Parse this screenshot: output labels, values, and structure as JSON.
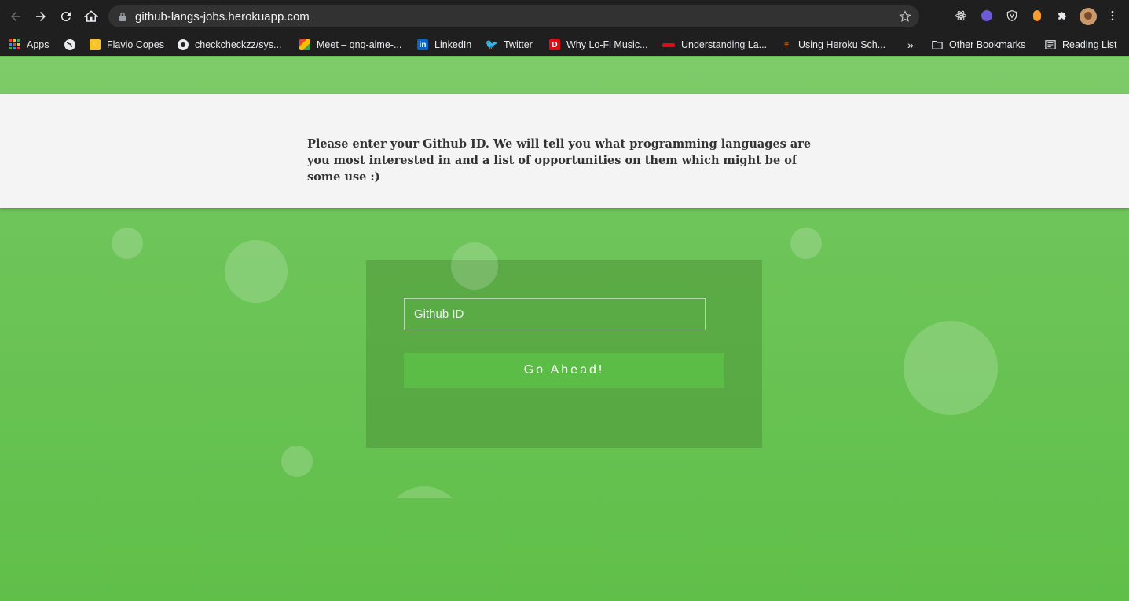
{
  "browser": {
    "url": "github-langs-jobs.herokuapp.com",
    "bookmarks": [
      {
        "label": "Apps",
        "icon": "apps-grid-icon"
      },
      {
        "label": "",
        "icon": "globe-icon"
      },
      {
        "label": "Flavio Copes",
        "icon": "flavio-copes-icon"
      },
      {
        "label": "checkcheckzz/sys...",
        "icon": "github-icon"
      },
      {
        "label": "Meet – qnq-aime-...",
        "icon": "meet-icon"
      },
      {
        "label": "LinkedIn",
        "icon": "linkedin-icon"
      },
      {
        "label": "Twitter",
        "icon": "twitter-icon"
      },
      {
        "label": "Why Lo-Fi Music...",
        "icon": "d-icon"
      },
      {
        "label": "Understanding La...",
        "icon": "red-bar-icon"
      },
      {
        "label": "Using Heroku Sch...",
        "icon": "stackoverflow-icon"
      }
    ],
    "overflow_label": "»",
    "other_bookmarks": "Other Bookmarks",
    "reading_list": "Reading List"
  },
  "page": {
    "intro_text": "Please enter your Github ID. We will tell you what programming languages are you most interested in and a list of opportunities on them which might be of some use :)",
    "input_placeholder": "Github ID",
    "submit_label": "Go Ahead!"
  },
  "colors": {
    "background_green": "#63c04c",
    "button_green": "#5bbd46",
    "banner": "#f4f4f4"
  }
}
